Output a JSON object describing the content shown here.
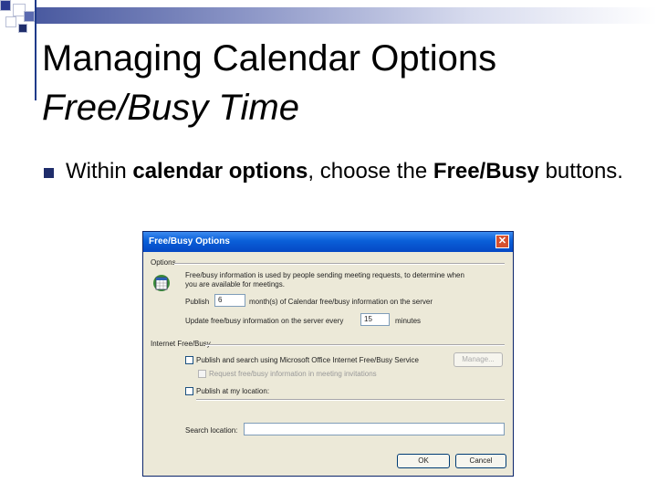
{
  "slide": {
    "title_line1": "Managing Calendar Options",
    "title_line2": "Free/Busy Time",
    "bullet": {
      "prefix": "Within ",
      "bold1": "calendar options",
      "middle": ", choose the ",
      "bold2": "Free/Busy",
      "suffix": " buttons."
    }
  },
  "dialog": {
    "title": "Free/Busy Options",
    "close_glyph": "✕",
    "options_group": "Options",
    "description_line1": "Free/busy information is used by people sending meeting requests, to determine when",
    "description_line2": "you are available for meetings.",
    "publish_label": "Publish",
    "publish_value": "6",
    "publish_suffix": "month(s) of Calendar free/busy information on the server",
    "update_label": "Update free/busy information on the server every",
    "update_value": "15",
    "update_suffix": "minutes",
    "internet_group": "Internet Free/Busy",
    "publish_search_label": "Publish and search using Microsoft Office Internet Free/Busy Service",
    "manage_button": "Manage...",
    "request_label": "Request free/busy information in meeting invitations",
    "publish_location_label": "Publish at my location:",
    "search_location_label": "Search location:",
    "ok_button": "OK",
    "cancel_button": "Cancel"
  }
}
